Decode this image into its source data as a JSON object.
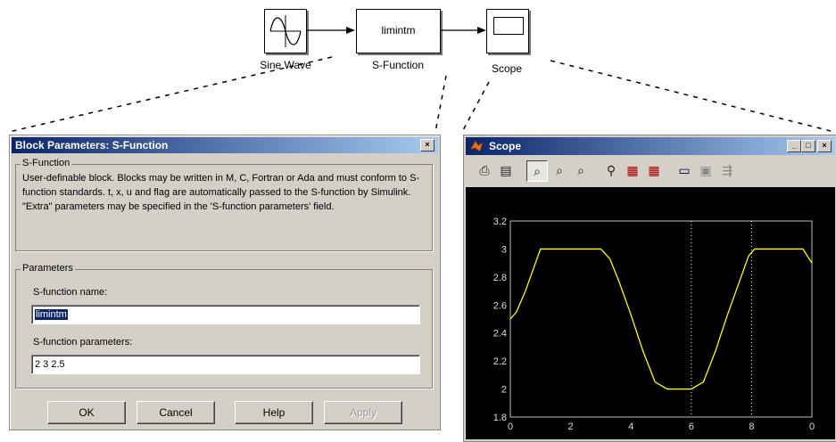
{
  "diagram": {
    "blocks": [
      {
        "label": "Sine Wave"
      },
      {
        "label": "S-Function",
        "inner": "limintm"
      },
      {
        "label": "Scope"
      }
    ]
  },
  "dialog": {
    "title": "Block Parameters: S-Function",
    "group1_title": "S-Function",
    "description": "User-definable block.  Blocks may be written in M, C, Fortran or Ada and must conform to S-function standards. t, x, u and flag are automatically passed to the S-function by Simulink.  \"Extra\" parameters may be specified in the 'S-function parameters' field.",
    "group2_title": "Parameters",
    "name_label": "S-function name:",
    "name_value": "limintm",
    "params_label": "S-function parameters:",
    "params_value": "2 3 2.5",
    "buttons": {
      "ok": "OK",
      "cancel": "Cancel",
      "help": "Help",
      "apply": "Apply"
    }
  },
  "scope": {
    "title": "Scope",
    "window_buttons": {
      "minimize": "_",
      "maximize": "□",
      "close": "×"
    },
    "toolbar_icons": [
      "print-icon",
      "parameters-icon",
      "zoom-icon",
      "zoom-x-icon",
      "zoom-y-icon",
      "autoscale-icon",
      "save-axes-icon",
      "restore-axes-icon",
      "floating-scope-icon",
      "lock-axes-icon",
      "signal-selector-icon"
    ]
  },
  "chart_data": {
    "type": "line",
    "xlim": [
      0,
      10
    ],
    "ylim": [
      1.8,
      3.2
    ],
    "x_ticks": [
      0,
      2,
      4,
      6,
      8,
      10
    ],
    "y_ticks": [
      1.8,
      2,
      2.2,
      2.4,
      2.6,
      2.8,
      3,
      3.2
    ],
    "x_tick_labels": [
      "0",
      "2",
      "4",
      "6",
      "8",
      "0"
    ],
    "y_tick_labels": [
      "1.8",
      "2",
      "2.2",
      "2.4",
      "2.6",
      "2.8",
      "3",
      "3.2"
    ],
    "grid": true,
    "background": "#000000",
    "line_color": "#ffff00",
    "series": [
      {
        "x": [
          0,
          0.2,
          0.5,
          0.8,
          1.0,
          1.2,
          3.0,
          3.3,
          3.6,
          4.0,
          4.4,
          4.8,
          5.2,
          6.0,
          6.4,
          6.8,
          7.2,
          7.6,
          7.9,
          8.1,
          9.7,
          10.0
        ],
        "y": [
          2.5,
          2.55,
          2.7,
          2.88,
          3.0,
          3.0,
          3.0,
          2.93,
          2.77,
          2.53,
          2.27,
          2.05,
          2.0,
          2.0,
          2.05,
          2.27,
          2.53,
          2.77,
          2.95,
          3.0,
          3.0,
          2.9
        ]
      }
    ],
    "markers_x": [
      6,
      8
    ]
  }
}
